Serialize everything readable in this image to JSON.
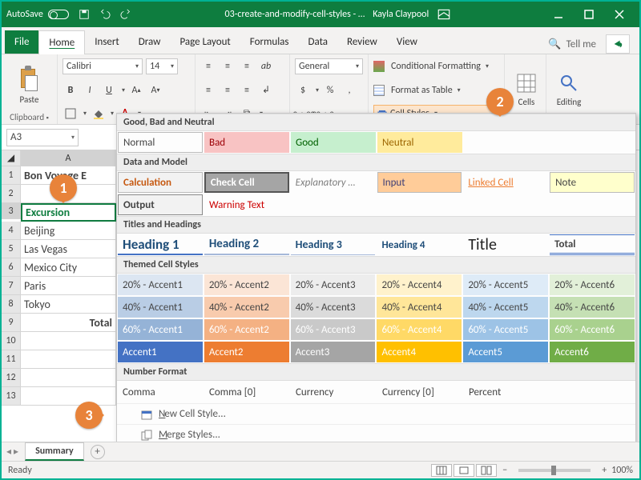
{
  "titlebar": {
    "autosave": "AutoSave",
    "doc": "03-create-and-modify-cell-styles - …",
    "user": "Kayla Claypool"
  },
  "tabs": {
    "file": "File",
    "home": "Home",
    "insert": "Insert",
    "draw": "Draw",
    "pagelayout": "Page Layout",
    "formulas": "Formulas",
    "data": "Data",
    "review": "Review",
    "view": "View",
    "tellme": "Tell me"
  },
  "ribbon": {
    "clipboard": {
      "paste": "Paste",
      "label": "Clipboard"
    },
    "font": {
      "name": "Calibri",
      "size": "14"
    },
    "number": {
      "format": "General"
    },
    "styles": {
      "cond": "Conditional Formatting",
      "fmt": "Format as Table",
      "cell": "Cell Styles"
    },
    "cells": "Cells",
    "editing": "Editing"
  },
  "namebox": "A3",
  "rows": {
    "r1": "Bon Voyage E",
    "r3": "Excursion",
    "r4": "Beijing",
    "r5": "Las Vegas",
    "r6": "Mexico City",
    "r7": "Paris",
    "r8": "Tokyo",
    "r9": "Total"
  },
  "colA": "A",
  "gallery": {
    "sec1": "Good, Bad and Neutral",
    "row1": {
      "a": "Normal",
      "b": "Bad",
      "c": "Good",
      "d": "Neutral"
    },
    "sec2": "Data and Model",
    "row2": {
      "a": "Calculation",
      "b": "Check Cell",
      "c": "Explanatory …",
      "d": "Input",
      "e": "Linked Cell",
      "f": "Note"
    },
    "row3": {
      "a": "Output",
      "b": "Warning Text"
    },
    "sec3": "Titles and Headings",
    "row4": {
      "a": "Heading 1",
      "b": "Heading 2",
      "c": "Heading 3",
      "d": "Heading 4",
      "e": "Title",
      "f": "Total"
    },
    "sec4": "Themed Cell Styles",
    "r20": [
      "20% - Accent1",
      "20% - Accent2",
      "20% - Accent3",
      "20% - Accent4",
      "20% - Accent5",
      "20% - Accent6"
    ],
    "r40": [
      "40% - Accent1",
      "40% - Accent2",
      "40% - Accent3",
      "40% - Accent4",
      "40% - Accent5",
      "40% - Accent6"
    ],
    "r60": [
      "60% - Accent1",
      "60% - Accent2",
      "60% - Accent3",
      "60% - Accent4",
      "60% - Accent5",
      "60% - Accent6"
    ],
    "rA": [
      "Accent1",
      "Accent2",
      "Accent3",
      "Accent4",
      "Accent5",
      "Accent6"
    ],
    "sec5": "Number Format",
    "row5": {
      "a": "Comma",
      "b": "Comma [0]",
      "c": "Currency",
      "d": "Currency [0]",
      "e": "Percent"
    },
    "new": "New Cell Style...",
    "merge": "Merge Styles..."
  },
  "sheet": {
    "tab": "Summary"
  },
  "status": {
    "ready": "Ready",
    "zoom": "100%"
  },
  "markers": {
    "m1": "1",
    "m2": "2",
    "m3": "3"
  },
  "accent20": [
    "#dce6f2",
    "#fbe5d6",
    "#ededed",
    "#fff2cc",
    "#deebf7",
    "#e2f0d9"
  ],
  "accent40": [
    "#b9cde5",
    "#f8cbad",
    "#dbdbdb",
    "#ffe699",
    "#bdd7ee",
    "#c5e0b4"
  ],
  "accent60": [
    "#95b3d7",
    "#f4b183",
    "#c9c9c9",
    "#ffd966",
    "#9dc3e6",
    "#a9d18e"
  ],
  "accent": [
    "#4472c4",
    "#ed7d31",
    "#a5a5a5",
    "#ffc000",
    "#5b9bd5",
    "#70ad47"
  ]
}
